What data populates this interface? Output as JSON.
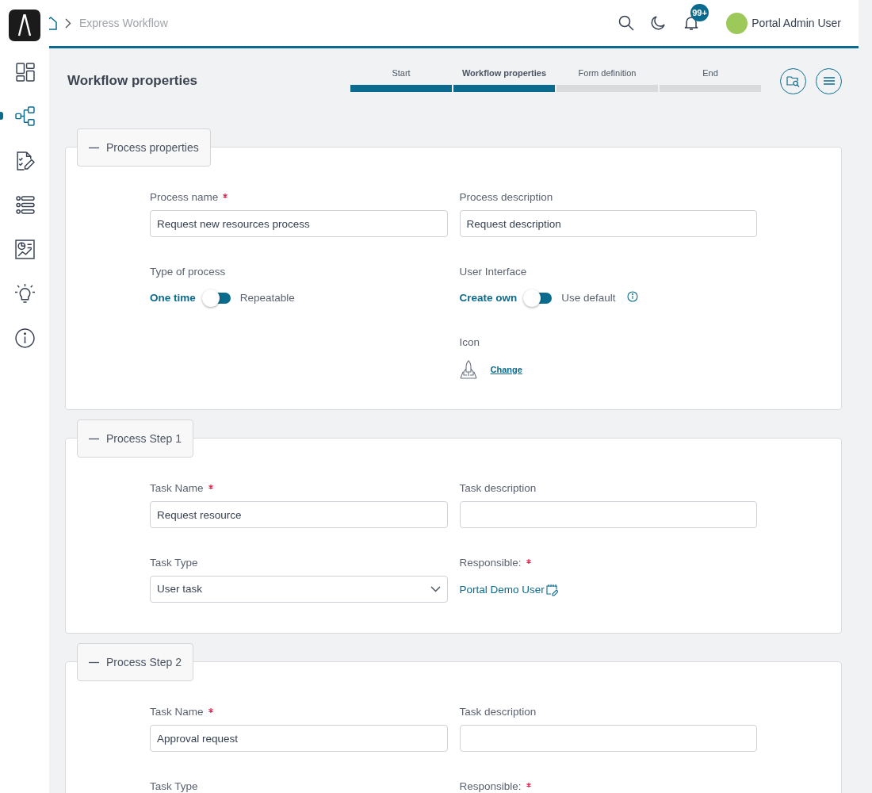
{
  "sidebar": {
    "items": [
      {
        "selected": false
      },
      {
        "selected": true
      },
      {
        "selected": false
      },
      {
        "selected": false
      },
      {
        "selected": false
      },
      {
        "selected": false
      },
      {
        "selected": false
      }
    ]
  },
  "header": {
    "breadcrumb": [
      "Express Workflow"
    ],
    "notification_badge": "99+",
    "user_name": "Portal Admin User"
  },
  "page": {
    "title": "Workflow properties"
  },
  "stepper": [
    {
      "label": "Start",
      "completed": true,
      "selected": false
    },
    {
      "label": "Workflow properties",
      "completed": true,
      "selected": true
    },
    {
      "label": "Form definition",
      "completed": false,
      "selected": false
    },
    {
      "label": "End",
      "completed": false,
      "selected": false
    }
  ],
  "sections": [
    {
      "title": "Process properties",
      "expanded": true,
      "columns": [
        [
          {
            "kind": "text",
            "label": "Process name",
            "required": true,
            "value": "Request new resources process"
          },
          {
            "kind": "toggle",
            "label": "Type of process",
            "required": false,
            "options": [
              {
                "label": "One time",
                "selected": true
              },
              {
                "label": "Repeatable",
                "selected": false
              }
            ]
          }
        ],
        [
          {
            "kind": "text",
            "label": "Process description",
            "required": false,
            "value": "Request description"
          },
          {
            "kind": "toggle",
            "label": "User Interface",
            "required": false,
            "info": true,
            "options": [
              {
                "label": "Create own",
                "selected": true
              },
              {
                "label": "Use default",
                "selected": false
              }
            ]
          },
          {
            "kind": "icon",
            "label": "Icon",
            "required": false,
            "link": "Change"
          }
        ]
      ]
    },
    {
      "title": "Process Step 1",
      "expanded": true,
      "columns": [
        [
          {
            "kind": "text",
            "label": "Task Name",
            "required": true,
            "value": "Request resource"
          },
          {
            "kind": "select",
            "label": "Task Type",
            "required": false,
            "value": "User task"
          }
        ],
        [
          {
            "kind": "text",
            "label": "Task description",
            "required": false
          },
          {
            "kind": "user",
            "label": "Responsible:",
            "required": true,
            "value": "Portal Demo User"
          }
        ]
      ]
    },
    {
      "title": "Process Step 2",
      "expanded": true,
      "columns": [
        [
          {
            "kind": "text",
            "label": "Task Name",
            "required": true,
            "value": "Approval request"
          },
          {
            "kind": "select",
            "label": "Task Type",
            "required": false
          }
        ],
        [
          {
            "kind": "text",
            "label": "Task description",
            "required": false
          },
          {
            "kind": "user",
            "label": "Responsible:",
            "required": true
          }
        ]
      ]
    }
  ]
}
